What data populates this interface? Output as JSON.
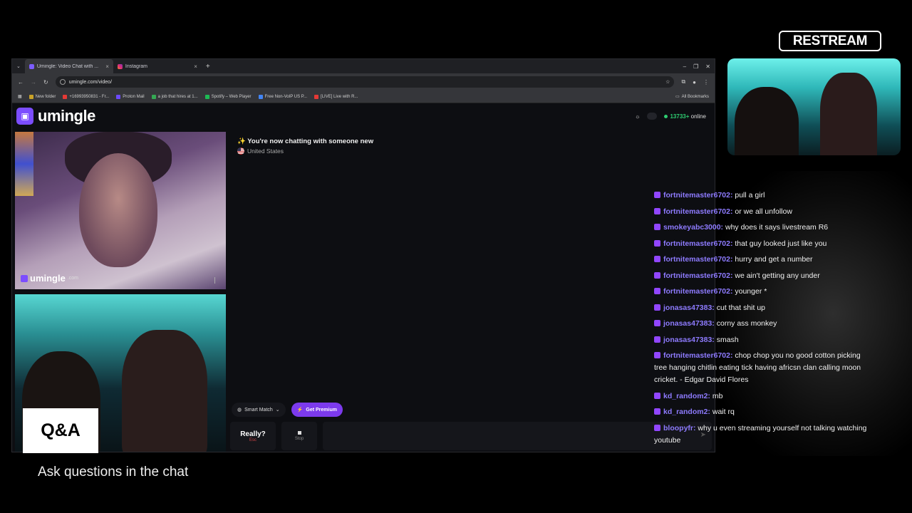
{
  "browser": {
    "tabs": [
      {
        "label": "Umingle: Video Chat with ..."
      },
      {
        "label": "Instagram"
      }
    ],
    "new_tab": "+",
    "url": "umingle.com/video/",
    "bookmarks": [
      {
        "label": "New folder",
        "color": "#c9a227"
      },
      {
        "label": "+16993950831 - Fr...",
        "color": "#e53935"
      },
      {
        "label": "Proton Mail",
        "color": "#6d4aff"
      },
      {
        "label": "a job that hires at 1...",
        "color": "#34a853"
      },
      {
        "label": "Spotify – Web Player",
        "color": "#1db954"
      },
      {
        "label": "Free Non-VoIP US P...",
        "color": "#4285f4"
      },
      {
        "label": "[LIVE] Live with R...",
        "color": "#e53935"
      }
    ],
    "all_bookmarks": "All Bookmarks"
  },
  "site": {
    "logo": "umingle",
    "online_count": "13733+",
    "online_label": "online",
    "status": "✨ You're now chatting with someone new",
    "country": "United States",
    "watermark": "umingle",
    "watermark_suffix": ".com",
    "smart_match": "Smart Match",
    "premium": "Get Premium",
    "really": "Really?",
    "esc": "Esc",
    "stop": "Stop"
  },
  "overlay": {
    "restream": "RESTREAM",
    "qa_title": "Q&A",
    "qa_subtitle": "Ask questions in the chat"
  },
  "chat_messages": [
    {
      "user": "fortnitemaster6702:",
      "text": "pull a girl"
    },
    {
      "user": "fortnitemaster6702:",
      "text": "or we all unfollow"
    },
    {
      "user": "smokeyabc3000:",
      "text": "why does it says livestream R6"
    },
    {
      "user": "fortnitemaster6702:",
      "text": "that guy looked just like you"
    },
    {
      "user": "fortnitemaster6702:",
      "text": "hurry and get a number"
    },
    {
      "user": "fortnitemaster6702:",
      "text": "we ain't getting any under"
    },
    {
      "user": "fortnitemaster6702:",
      "text": "younger *"
    },
    {
      "user": "jonasas47383:",
      "text": "cut that shit up"
    },
    {
      "user": "jonasas47383:",
      "text": "corny ass monkey"
    },
    {
      "user": "jonasas47383:",
      "text": "smash"
    },
    {
      "user": "fortnitemaster6702:",
      "text": "chop chop you no good cotton picking tree hanging chitlin eating tick having africsn clan calling moon cricket. - Edgar David Flores"
    },
    {
      "user": "kd_random2:",
      "text": "mb"
    },
    {
      "user": "kd_random2:",
      "text": "wait rq"
    },
    {
      "user": "bloopyfr:",
      "text": "why u even streaming yourself not talking watching youtube"
    }
  ]
}
